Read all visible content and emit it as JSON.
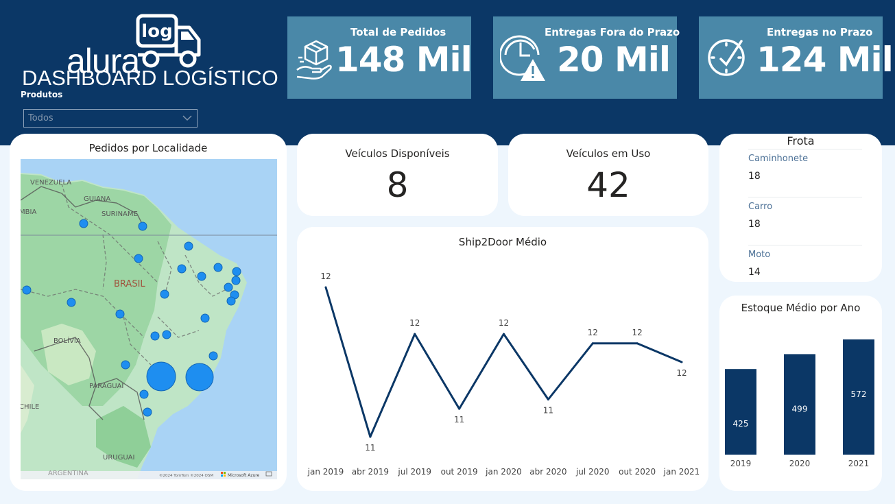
{
  "logo": {
    "word": "alura",
    "badge": "log",
    "subtitle": "DASHBOARD LOGÍSTICO"
  },
  "filter": {
    "label": "Produtos",
    "value": "Todos"
  },
  "kpis": [
    {
      "title": "Total de Pedidos",
      "value": "148 Mil",
      "icon": "package-hand-icon"
    },
    {
      "title": "Entregas Fora do Prazo",
      "value": "20 Mil",
      "icon": "clock-warning-icon"
    },
    {
      "title": "Entregas no Prazo",
      "value": "124 Mil",
      "icon": "clock-check-icon"
    }
  ],
  "map_card": {
    "title": "Pedidos por Localidade",
    "labels": [
      "VENEZUELA",
      "GUIANA",
      "SURINAME",
      "MBIA",
      "BRASIL",
      "BOLÍVIA",
      "PARAGUAI",
      "CHILE",
      "URUGUAI",
      "ARGENTINA"
    ],
    "attribution": "©2024 TomTom ©2024 OSM",
    "provider": "Microsoft Azure"
  },
  "vehicles_available": {
    "title": "Veículos Disponíveis",
    "value": "8"
  },
  "vehicles_in_use": {
    "title": "Veículos em Uso",
    "value": "42"
  },
  "fleet": {
    "title": "Frota",
    "items": [
      {
        "label": "Caminhonete",
        "value": "18"
      },
      {
        "label": "Carro",
        "value": "18"
      },
      {
        "label": "Moto",
        "value": "14"
      }
    ]
  },
  "chart_data": [
    {
      "type": "line",
      "title": "Ship2Door Médio",
      "categories": [
        "jan 2019",
        "abr 2019",
        "jul 2019",
        "out 2019",
        "jan 2020",
        "abr 2020",
        "jul 2020",
        "out 2020",
        "jan 2021"
      ],
      "tick_labels": [
        "jan 2019",
        "abr 2019",
        "jul 2019",
        "out 2019",
        "jan 2020",
        "abr 2020",
        "jul 2020",
        "out 2020",
        "jan 2021"
      ],
      "values": [
        12.4,
        10.8,
        11.9,
        11.1,
        11.9,
        11.2,
        11.8,
        11.8,
        11.6
      ],
      "data_labels": [
        "12",
        "11",
        "12",
        "11",
        "12",
        "11",
        "12",
        "12",
        "12"
      ],
      "color": "#0b3766"
    },
    {
      "type": "bar",
      "title": "Estoque Médio por Ano",
      "categories": [
        "2019",
        "2020",
        "2021"
      ],
      "values": [
        425,
        499,
        572
      ],
      "color": "#0b3766"
    }
  ],
  "colors": {
    "header": "#0b3766",
    "kpi": "#4a88a8",
    "background": "#eef6fd",
    "bubble": "#1e8ef0"
  }
}
